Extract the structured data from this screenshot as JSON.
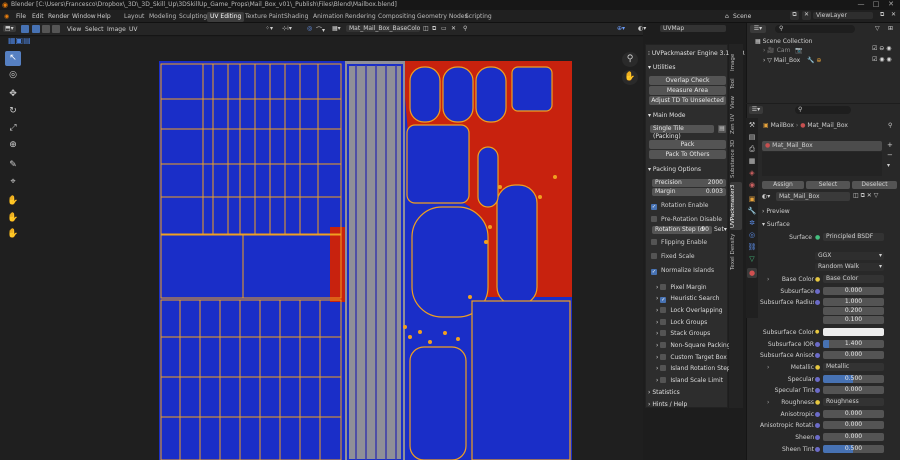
{
  "title_bar": {
    "text": "Blender [C:\\Users\\Francesco\\Dropbox\\_3D\\_3D_Skill_Up\\3DSkillUp_Game_Props\\Mail_Box_v01\\_Publish\\Files\\Blend\\Mailbox.blend]"
  },
  "menu": {
    "items": [
      "File",
      "Edit",
      "Render",
      "Window",
      "Help"
    ],
    "workspaces": [
      "Layout",
      "Modeling",
      "Sculpting",
      "UV Editing",
      "Texture Paint",
      "Shading",
      "Animation",
      "Rendering",
      "Compositing",
      "Geometry Nodes",
      "Scripting"
    ],
    "scene_label": "Scene",
    "view_layer": "ViewLayer"
  },
  "uv_header": {
    "menus": [
      "View",
      "Select",
      "Image",
      "UV"
    ],
    "image_name": "Mat_Mail_Box_BaseColor.png",
    "uvmap": "UVMap"
  },
  "npanel": {
    "title": "UVPackmaster Engine 3.1.3 PR",
    "utilities_label": "Utilities",
    "overlap_check": "Overlap Check",
    "measure_area": "Measure Area",
    "adjust_td": "Adjust TD To Unselected",
    "main_mode_label": "Main Mode",
    "mode_value": "Single Tile (Packing)",
    "pack": "Pack",
    "pack_to_others": "Pack To Others",
    "packing_options_label": "Packing Options",
    "precision_label": "Precision",
    "precision_value": "2000",
    "margin_label": "Margin",
    "margin_value": "0.003",
    "rotation_enable": "Rotation Enable",
    "pre_rotation_disable": "Pre-Rotation Disable",
    "rotation_step_label": "Rotation Step (d",
    "rotation_step_value": "90",
    "rotation_step_set": "Set",
    "flipping_enable": "Flipping Enable",
    "fixed_scale": "Fixed Scale",
    "normalize_islands": "Normalize Islands",
    "subpanels": [
      "Pixel Margin",
      "Heuristic Search",
      "Lock Overlapping",
      "Lock Groups",
      "Stack Groups",
      "Non-Square Packing",
      "Custom Target Box",
      "Island Rotation Step",
      "Island Scale Limit"
    ],
    "statistics": "Statistics",
    "hints_help": "Hints / Help"
  },
  "side_tabs": [
    "Image",
    "Tool",
    "View",
    "Zen UV",
    "Substance 3D",
    "UVPackmaster3",
    "Texel Density"
  ],
  "outliner": {
    "collection": "Scene Collection",
    "items": [
      "Cam",
      "Mail_Box"
    ]
  },
  "properties": {
    "object": "MailBox",
    "material_path": "Mat_Mail_Box",
    "slot": "Mat_Mail_Box",
    "assign": "Assign",
    "select": "Select",
    "deselect": "Deselect",
    "material_name": "Mat_Mail_Box",
    "preview": "Preview",
    "surface_section": "Surface",
    "surface_label": "Surface",
    "surface_value": "Principled BSDF",
    "distribution": "GGX",
    "subsurface_method": "Random Walk",
    "rows": [
      {
        "label": "Base Color",
        "value": "Base Color"
      },
      {
        "label": "Subsurface",
        "value": "0.000"
      },
      {
        "label": "Subsurface Radius",
        "value": "1.000"
      },
      {
        "label": "",
        "value": "0.200"
      },
      {
        "label": "",
        "value": "0.100"
      },
      {
        "label": "Subsurface Color",
        "value": ""
      },
      {
        "label": "Subsurface IOR",
        "value": "1.400"
      },
      {
        "label": "Subsurface Anisot...",
        "value": "0.000"
      },
      {
        "label": "Metallic",
        "value": "Metallic"
      },
      {
        "label": "Specular",
        "value": "0.500"
      },
      {
        "label": "Specular Tint",
        "value": "0.000"
      },
      {
        "label": "Roughness",
        "value": "Roughness"
      },
      {
        "label": "Anisotropic",
        "value": "0.000"
      },
      {
        "label": "Anisotropic Rotati...",
        "value": "0.000"
      },
      {
        "label": "Sheen",
        "value": "0.000"
      },
      {
        "label": "Sheen Tint",
        "value": "0.500"
      }
    ]
  },
  "colors": {
    "uv_blue": "#1a2ec8",
    "uv_red": "#c8220e",
    "accent": "#4772b3",
    "edge_orange": "#f0a020"
  }
}
